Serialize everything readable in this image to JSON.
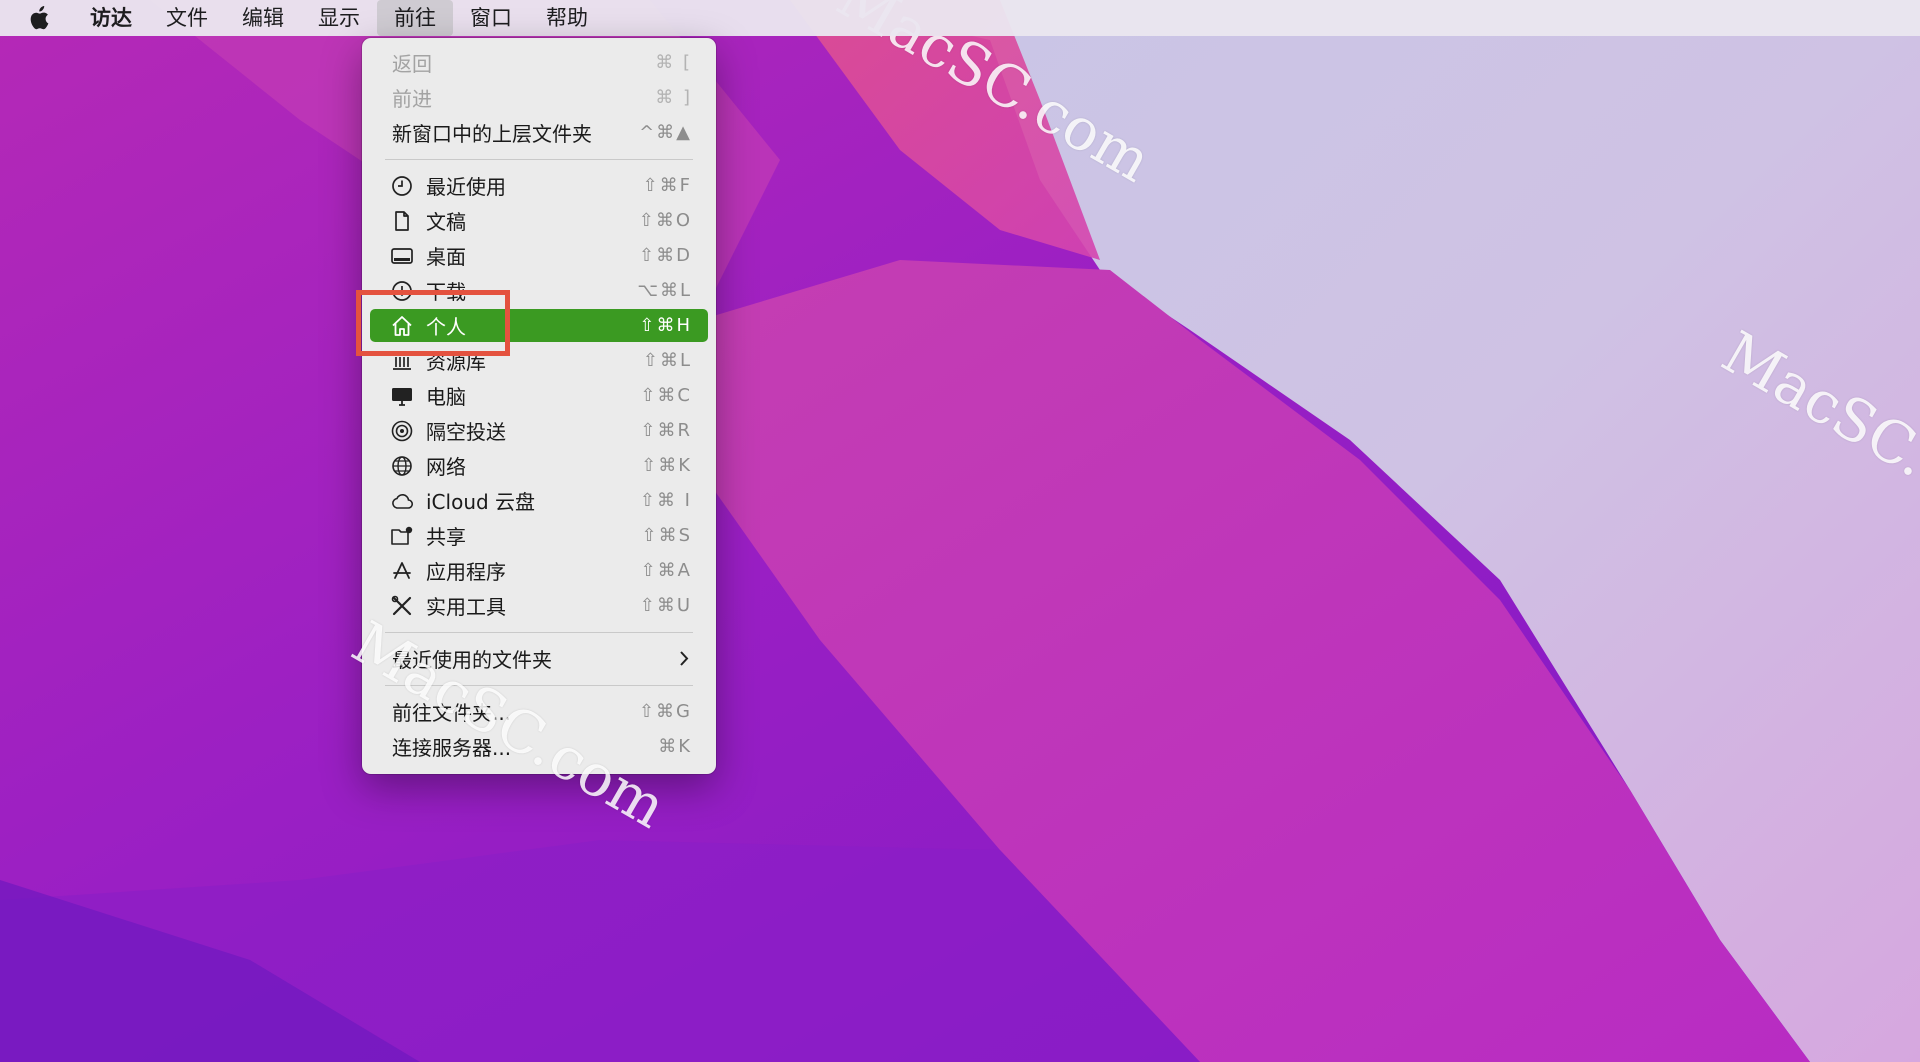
{
  "menubar": {
    "app_name": "访达",
    "items": [
      "文件",
      "编辑",
      "显示",
      "前往",
      "窗口",
      "帮助"
    ],
    "active_item": "前往"
  },
  "menu": {
    "items": [
      {
        "label": "返回",
        "shortcut": "⌘ [",
        "disabled": true
      },
      {
        "label": "前进",
        "shortcut": "⌘ ]",
        "disabled": true
      },
      {
        "label": "新窗口中的上层文件夹",
        "shortcut": "^⌘▲"
      },
      {
        "label": "最近使用",
        "shortcut": "⇧⌘F",
        "icon": "clock-icon"
      },
      {
        "label": "文稿",
        "shortcut": "⇧⌘O",
        "icon": "document-icon"
      },
      {
        "label": "桌面",
        "shortcut": "⇧⌘D",
        "icon": "desktop-icon"
      },
      {
        "label": "下载",
        "shortcut": "⌥⌘L",
        "icon": "download-icon"
      },
      {
        "label": "个人",
        "shortcut": "⇧⌘H",
        "icon": "home-icon",
        "selected": true
      },
      {
        "label": "资源库",
        "shortcut": "⇧⌘L",
        "icon": "library-icon"
      },
      {
        "label": "电脑",
        "shortcut": "⇧⌘C",
        "icon": "computer-icon"
      },
      {
        "label": "隔空投送",
        "shortcut": "⇧⌘R",
        "icon": "airdrop-icon"
      },
      {
        "label": "网络",
        "shortcut": "⇧⌘K",
        "icon": "network-icon"
      },
      {
        "label": "iCloud 云盘",
        "shortcut": "⇧⌘ I",
        "icon": "cloud-icon"
      },
      {
        "label": "共享",
        "shortcut": "⇧⌘S",
        "icon": "shared-folder-icon"
      },
      {
        "label": "应用程序",
        "shortcut": "⇧⌘A",
        "icon": "applications-icon"
      },
      {
        "label": "实用工具",
        "shortcut": "⇧⌘U",
        "icon": "utilities-icon"
      },
      {
        "label": "最近使用的文件夹",
        "submenu": true
      },
      {
        "label": "前往文件夹...",
        "shortcut": "⇧⌘G"
      },
      {
        "label": "连接服务器...",
        "shortcut": "⌘K"
      }
    ]
  },
  "watermark_text": "MacSC.com",
  "colors": {
    "selection": "#3b9a22",
    "annotation_box": "#e4523f"
  }
}
